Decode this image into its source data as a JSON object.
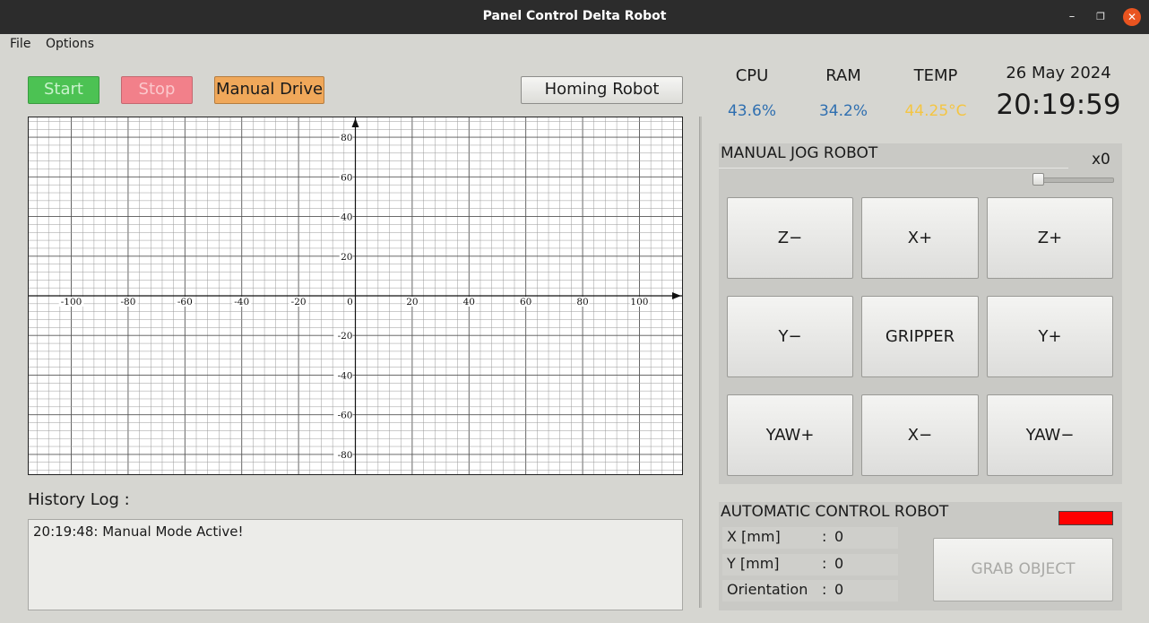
{
  "window": {
    "title": "Panel Control Delta Robot",
    "minimize_glyph": "–",
    "maximize_glyph": "❐",
    "close_glyph": "✕"
  },
  "menu": {
    "file": "File",
    "options": "Options"
  },
  "toolbar": {
    "start_label": "Start",
    "stop_label": "Stop",
    "manual_label": "Manual Drive",
    "homing_label": "Homing Robot"
  },
  "stats": {
    "cpu_label": "CPU",
    "cpu_value": "43.6%",
    "ram_label": "RAM",
    "ram_value": "34.2%",
    "temp_label": "TEMP",
    "temp_value": "44.25°C",
    "date": "26 May 2024",
    "time": "20:19:59"
  },
  "colors": {
    "cpu": "#2f6fb0",
    "ram": "#2f6fb0",
    "temp": "#f4c542",
    "status_indicator": "#ff0000",
    "start": "#4cc253",
    "stop": "#f2808a",
    "manual": "#f0a85a"
  },
  "graph": {
    "x_ticks": [
      -100,
      -80,
      -60,
      -40,
      -20,
      0,
      20,
      40,
      60,
      80,
      100
    ],
    "y_ticks": [
      80,
      60,
      40,
      20,
      -20,
      -40,
      -60,
      -80
    ],
    "x_range": [
      -115,
      115
    ],
    "y_range": [
      -90,
      90
    ]
  },
  "history": {
    "label": "History Log :",
    "entries": [
      "20:19:48: Manual Mode Active!"
    ]
  },
  "jog": {
    "title": "MANUAL JOG ROBOT",
    "speed_label": "x0",
    "buttons": [
      "Z−",
      "X+",
      "Z+",
      "Y−",
      "GRIPPER",
      "Y+",
      "YAW+",
      "X−",
      "YAW−"
    ]
  },
  "auto": {
    "title": "AUTOMATIC CONTROL ROBOT",
    "x_label": "X [mm]",
    "x_value": "0",
    "y_label": "Y [mm]",
    "y_value": "0",
    "orientation_label": "Orientation",
    "orientation_value": "0",
    "separator": ":",
    "grab_label": "GRAB OBJECT"
  }
}
